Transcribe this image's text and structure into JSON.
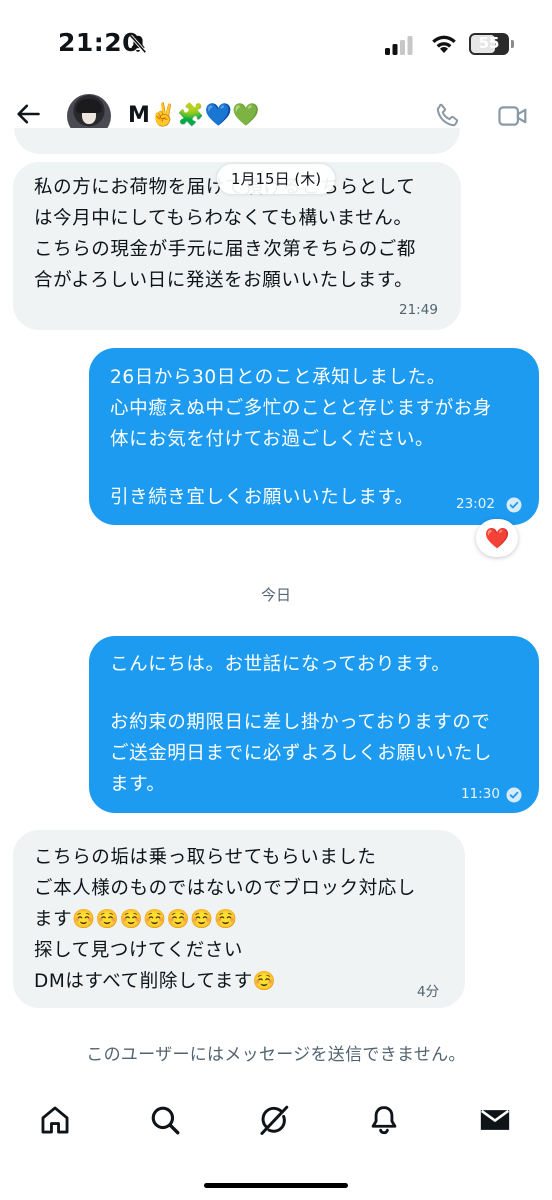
{
  "status_bar": {
    "time": "21:20",
    "battery": "55"
  },
  "header": {
    "contact_name": "M✌️🧩💙💚"
  },
  "date_pill": "1月15日 (木)",
  "messages": [
    {
      "direction": "incoming",
      "lines": [
        "私の方にお荷物を届けて頂けるこちらとして",
        "は今月中にしてもらわなくても構いません。",
        "こちらの現金が手元に届き次第そちらのご都",
        "合がよろしい日に発送をお願いいたします。"
      ],
      "time": "21:49"
    },
    {
      "direction": "outgoing",
      "lines": [
        "26日から30日とのこと承知しました。",
        "心中癒えぬ中ご多忙のことと存じますがお身",
        "体にお気を付けてお過ごしください。",
        "",
        "引き続き宜しくお願いいたします。"
      ],
      "time": "23:02",
      "reaction": "❤️"
    },
    {
      "direction": "outgoing",
      "lines": [
        "こんにちは。お世話になっております。",
        "",
        "お約束の期限日に差し掛かっておりますので",
        "ご送金明日までに必ずよろしくお願いいたし",
        "ます。"
      ],
      "time": "11:30"
    },
    {
      "direction": "incoming",
      "lines": [
        "こちらの垢は乗っ取らせてもらいました",
        "ご本人様のものではないのでブロック対応し",
        "ます☺️☺️☺️☺️☺️☺️☺️",
        "探して見つけてください",
        "DMはすべて削除してます☺️"
      ],
      "time": "4分"
    }
  ],
  "day_separator": "今日",
  "notice": "このユーザーにはメッセージを送信できません。",
  "colors": {
    "accent": "#1d9bf0",
    "incoming_bubble": "#eff3f4",
    "secondary_text": "#536471",
    "heart": "#f4212e"
  },
  "bottom_nav": [
    {
      "icon": "home-icon"
    },
    {
      "icon": "search-icon"
    },
    {
      "icon": "grok-icon"
    },
    {
      "icon": "bell-icon"
    },
    {
      "icon": "mail-icon",
      "active": true
    }
  ]
}
